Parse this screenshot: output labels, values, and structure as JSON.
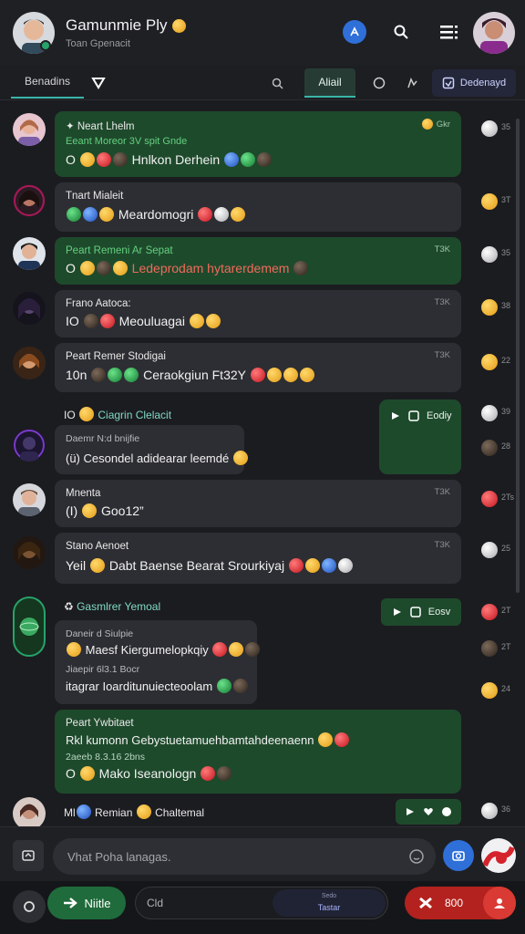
{
  "header": {
    "title": "Gamunmie Ply",
    "subtitle": "Toan Gpenacit",
    "icons": {
      "pin": "pin-icon",
      "search": "search-icon",
      "menu": "menu-icon"
    }
  },
  "tabs": {
    "folders": "Benadins",
    "active": "Aliail",
    "download": "Dedenayd"
  },
  "messages": [
    {
      "sender": "Neart Lhelm",
      "tag": "Eeant Moreor 3V spit Gnde",
      "body": "O",
      "body_text": "Hnlkon Derhein",
      "time": "Gkr"
    },
    {
      "sender": "Tnart Mialeit",
      "body_text": "Meardomogri",
      "time": ""
    },
    {
      "sender": "Peart Remeni Ar Sepat",
      "body": "O",
      "body_text": "Ledeprodam hytarerdemem",
      "time": "T3K"
    },
    {
      "sender": "Frano Aatoca:",
      "body": "IO",
      "body_text": "Meouluagai",
      "time": "T3K"
    },
    {
      "sender": "Peart Remer Stodigai",
      "body": "10n",
      "body_text": "Ceraokgiun Ft32Y",
      "time": "T3K"
    },
    {
      "sender": "IO",
      "header_text": "Ciagrin Clelacit",
      "sub": "Daemr N:d bnijfie",
      "body_text": "(ü) Cesondel adidearar leemdé",
      "action": "Eodiy"
    },
    {
      "sender": "Mnenta",
      "body": "(I)",
      "body_text": "Goo12”",
      "time": "T3K"
    },
    {
      "sender": "Stano Aenoet",
      "body": "Yeil",
      "body_text": "Dabt Baense Bearat Srourkiyaj",
      "time": "T3K"
    },
    {
      "sender": "Gasmlrer Yemoal",
      "sub1": "Daneir d Siulpie",
      "body1": "Maesf Kiergumelopkqiy",
      "sub2": "Jiaepir 6l3.1 Bocr",
      "body2": "itagrar Ioarditunuiecteoolam",
      "action": "Eosv"
    },
    {
      "sender": "Peart Ywbitaet",
      "tag": "Rkl kumonn Gebystuetamuehbamtahdeenaenn",
      "sub": "2aeeb 8.3.16 2bns",
      "body": "O",
      "body_text": "Mako Iseanologn"
    },
    {
      "sender": "Ml",
      "header_text": "Remian",
      "body_text": "Chaltemal"
    }
  ],
  "rail_times": [
    "35",
    "3T",
    "35",
    "38",
    "22",
    "39",
    "28",
    "2Ts",
    "25",
    "2T",
    "2T",
    "24",
    "36",
    "2T"
  ],
  "composer": {
    "placeholder": "Vhat Poha lanagas."
  },
  "bottom": {
    "next": "Niitle",
    "field": "Cld",
    "chip_top": "Sedo",
    "chip_bottom": "Tastar",
    "end": "800"
  },
  "colors": {
    "accent": "#38b6a8",
    "bubble_green": "#1e4a2c",
    "bubble_dark": "#2d2e33",
    "primary_blue": "#2f6fd8",
    "danger": "#b3221e"
  }
}
